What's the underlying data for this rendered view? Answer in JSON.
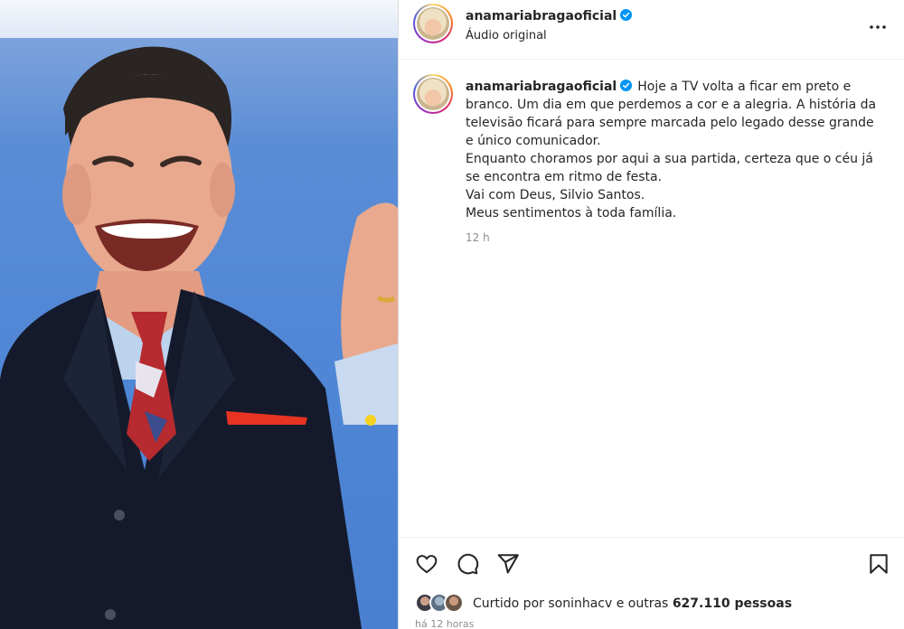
{
  "post": {
    "author": "anamariabragaoficial",
    "audio": "Áudio original",
    "caption_username": "anamariabragaoficial",
    "caption_text": "Hoje a TV volta a ficar em preto e\nbranco. Um dia em que perdemos a cor e a alegria. A história da\ntelevisão ficará para sempre marcada pelo legado desse grande\ne único comunicador.\nEnquanto choramos por aqui a sua partida, certeza que o céu já\nse encontra em ritmo de festa.\nVai com Deus, Silvio Santos.\nMeus sentimentos à toda família.",
    "time_ago": "12 h",
    "liked_by_prefix": "Curtido por ",
    "liked_by_user": "soninhacv",
    "liked_by_and": " e outras ",
    "liked_count": "627.110 pessoas",
    "posted_ago": "há 12 horas"
  },
  "icons": {
    "more": "more-options-icon",
    "like": "heart-icon",
    "comment": "comment-bubble-icon",
    "share": "paper-plane-icon",
    "save": "bookmark-icon",
    "verified": "verified-badge-icon"
  },
  "colors": {
    "verified": "#0095f6",
    "text": "#262626",
    "muted": "#8e8e8e",
    "backdrop": "#4f86d6"
  }
}
